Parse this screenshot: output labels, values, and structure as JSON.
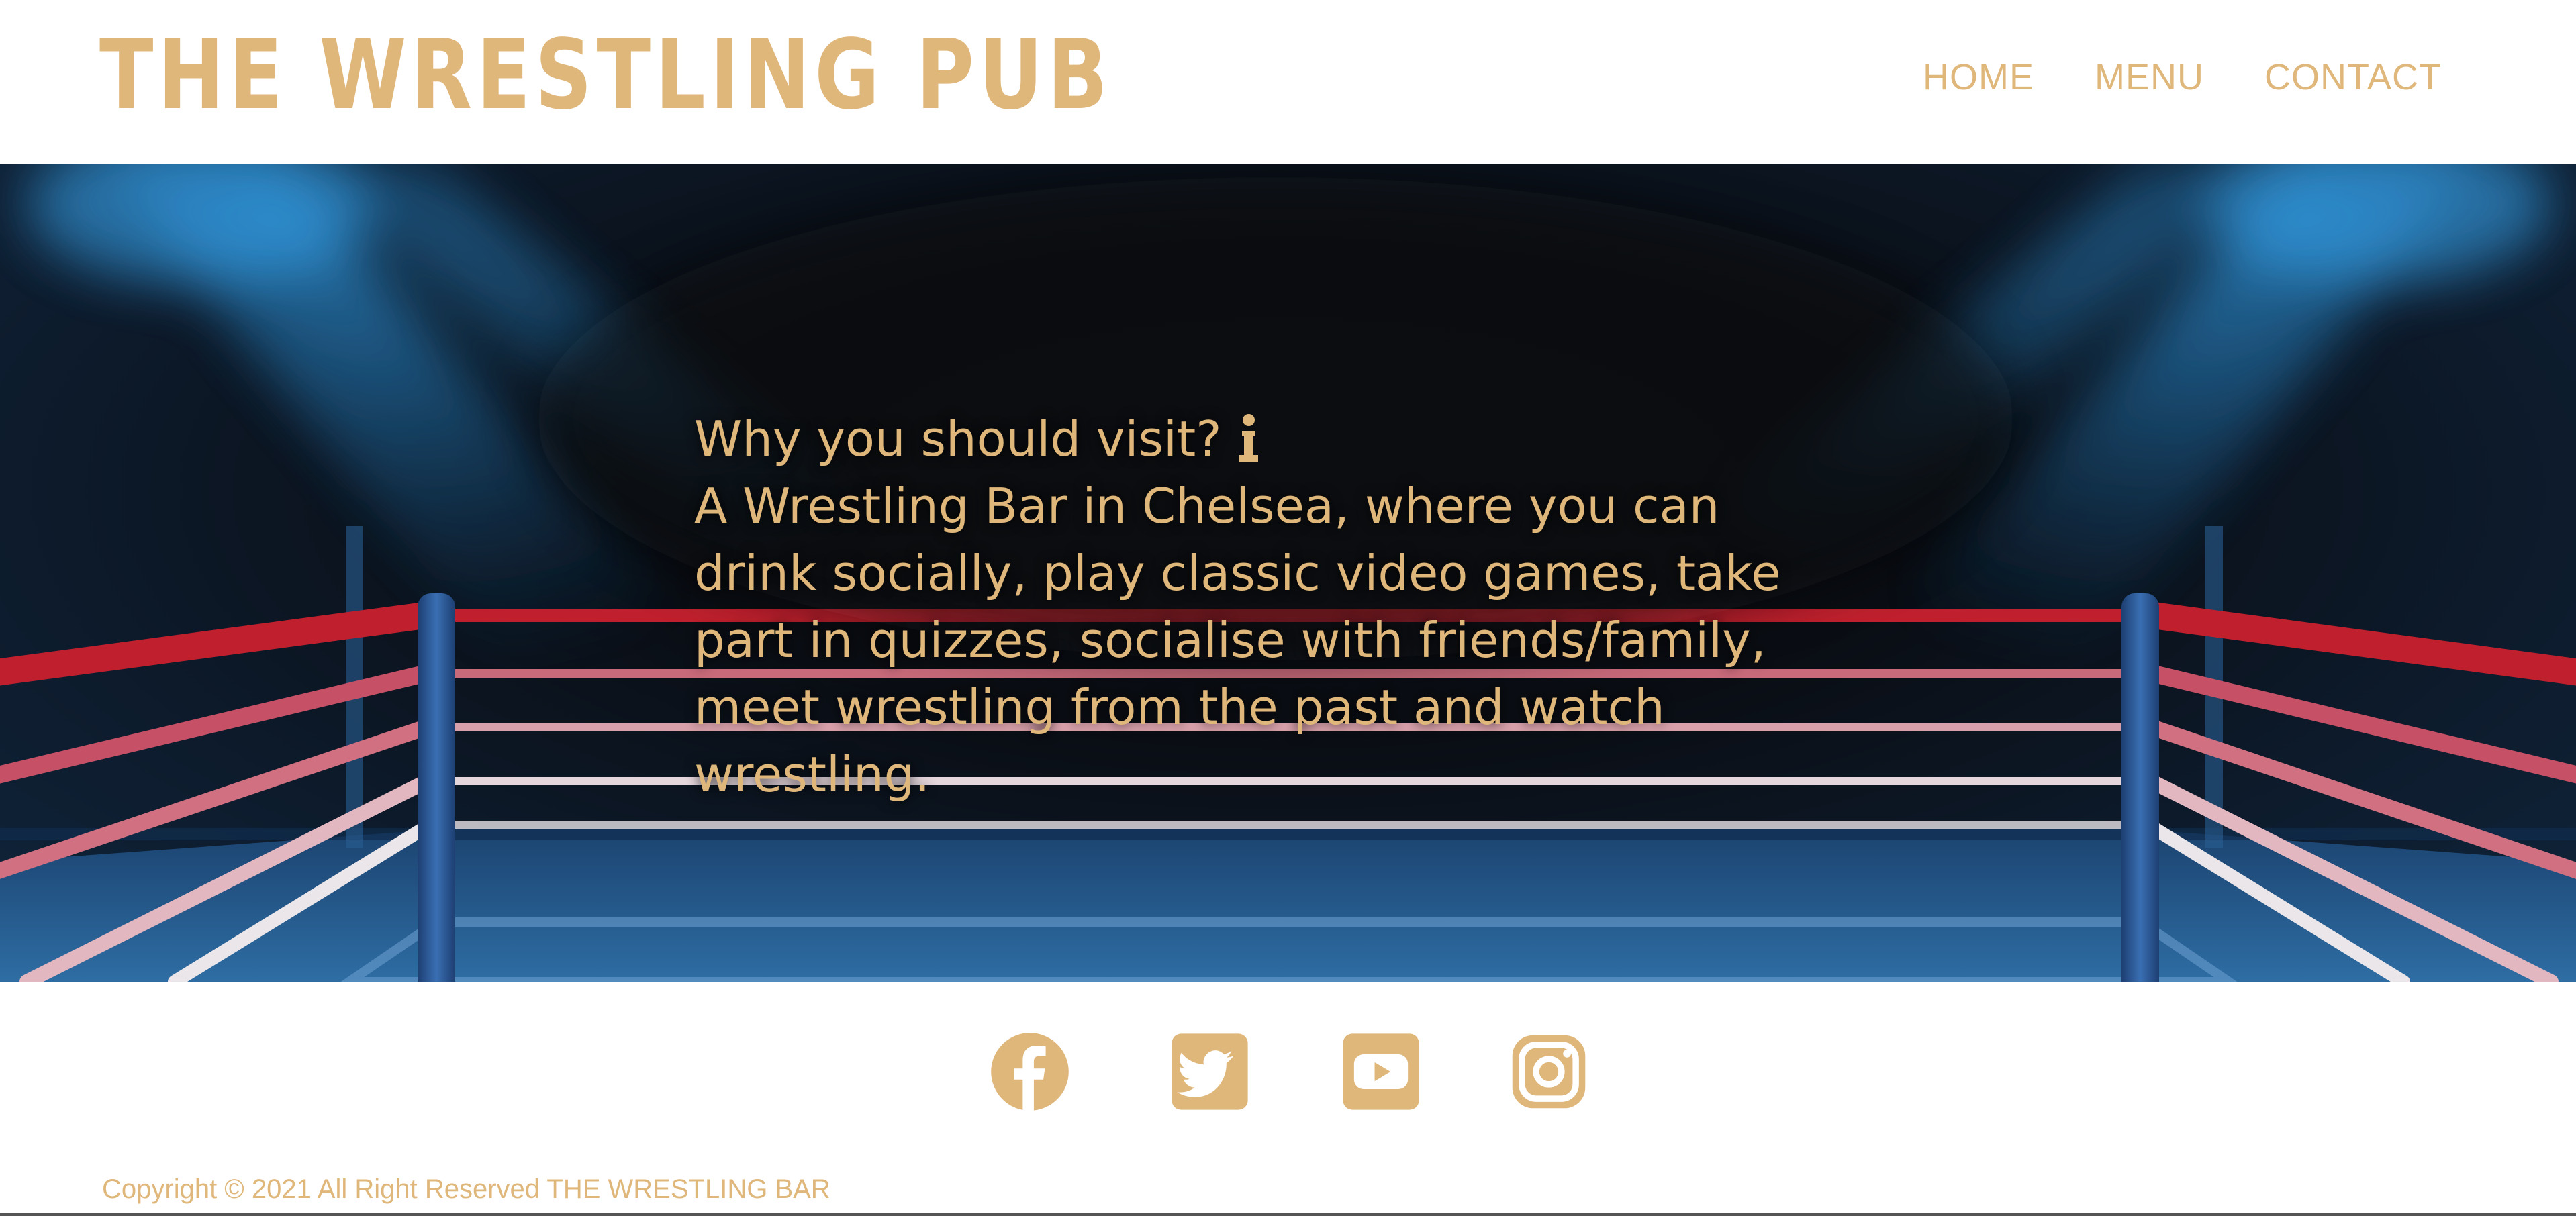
{
  "header": {
    "brand": "THE WRESTLING PUB",
    "nav": [
      "HOME",
      "MENU",
      "CONTACT"
    ]
  },
  "hero": {
    "heading": "Why you should visit?",
    "heading_icon": "info-icon",
    "body": "A Wrestling Bar in Chelsea, where you can drink socially, play classic video games, take part in quizzes, socialise with friends/family, meet wrestling from the past and watch wrestling."
  },
  "social": {
    "icons": [
      "facebook-icon",
      "twitter-icon",
      "youtube-icon",
      "instagram-icon"
    ]
  },
  "footer": {
    "copyright": "Copyright © 2021 All Right Reserved THE WRESTLING BAR"
  },
  "colors": {
    "accent": "#e0b77a",
    "background": "#ffffff",
    "hero_dark": "#0a0d13",
    "rope_red": "#c0202e",
    "ring_blue": "#2a5f93"
  }
}
